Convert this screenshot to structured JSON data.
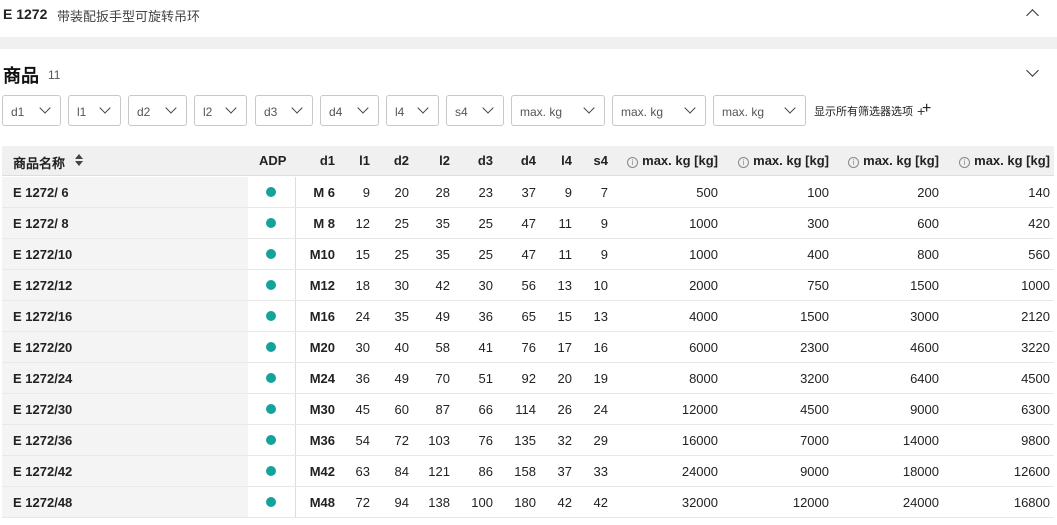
{
  "header": {
    "code": "E 1272",
    "description": "带装配扳手型可旋转吊环"
  },
  "products": {
    "title": "商品",
    "count": "11"
  },
  "filters": [
    "d1",
    "l1",
    "d2",
    "l2",
    "d3",
    "d4",
    "l4",
    "s4",
    "max. kg",
    "max. kg",
    "max. kg"
  ],
  "show_all_label": "显示所有筛选器选项 +",
  "table": {
    "columns": [
      "商品名称",
      "ADP",
      "d1",
      "l1",
      "d2",
      "l2",
      "d3",
      "d4",
      "l4",
      "s4",
      "max. kg [kg]",
      "max. kg [kg]",
      "max. kg [kg]",
      "max. kg [kg]"
    ],
    "rows": [
      [
        "E 1272/ 6",
        "M 6",
        "9",
        "20",
        "28",
        "23",
        "37",
        "9",
        "7",
        "500",
        "100",
        "200",
        "140"
      ],
      [
        "E 1272/ 8",
        "M 8",
        "12",
        "25",
        "35",
        "25",
        "47",
        "11",
        "9",
        "1000",
        "300",
        "600",
        "420"
      ],
      [
        "E 1272/10",
        "M10",
        "15",
        "25",
        "35",
        "25",
        "47",
        "11",
        "9",
        "1000",
        "400",
        "800",
        "560"
      ],
      [
        "E 1272/12",
        "M12",
        "18",
        "30",
        "42",
        "30",
        "56",
        "13",
        "10",
        "2000",
        "750",
        "1500",
        "1000"
      ],
      [
        "E 1272/16",
        "M16",
        "24",
        "35",
        "49",
        "36",
        "65",
        "15",
        "13",
        "4000",
        "1500",
        "3000",
        "2120"
      ],
      [
        "E 1272/20",
        "M20",
        "30",
        "40",
        "58",
        "41",
        "76",
        "17",
        "16",
        "6000",
        "2300",
        "4600",
        "3220"
      ],
      [
        "E 1272/24",
        "M24",
        "36",
        "49",
        "70",
        "51",
        "92",
        "20",
        "19",
        "8000",
        "3200",
        "6400",
        "4500"
      ],
      [
        "E 1272/30",
        "M30",
        "45",
        "60",
        "87",
        "66",
        "114",
        "26",
        "24",
        "12000",
        "4500",
        "9000",
        "6300"
      ],
      [
        "E 1272/36",
        "M36",
        "54",
        "72",
        "103",
        "76",
        "135",
        "32",
        "29",
        "16000",
        "7000",
        "14000",
        "9800"
      ],
      [
        "E 1272/42",
        "M42",
        "63",
        "84",
        "121",
        "86",
        "158",
        "37",
        "33",
        "24000",
        "9000",
        "18000",
        "12600"
      ],
      [
        "E 1272/48",
        "M48",
        "72",
        "94",
        "138",
        "100",
        "180",
        "42",
        "42",
        "32000",
        "12000",
        "24000",
        "16800"
      ]
    ]
  },
  "colors": {
    "adp_dot": "#13a39a",
    "header_bg": "#f0f0f0"
  }
}
